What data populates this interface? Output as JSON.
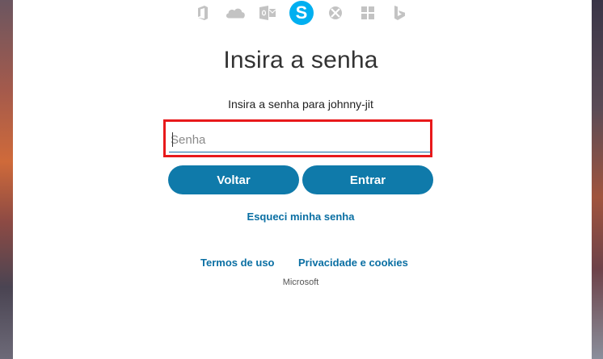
{
  "services": [
    {
      "name": "office-icon"
    },
    {
      "name": "onedrive-icon"
    },
    {
      "name": "outlook-icon"
    },
    {
      "name": "skype-icon",
      "glyph": "S",
      "active": true
    },
    {
      "name": "xbox-icon"
    },
    {
      "name": "windows-icon"
    },
    {
      "name": "bing-icon"
    }
  ],
  "page": {
    "title": "Insira a senha",
    "subtitle": "Insira a senha para johnny-jit"
  },
  "password": {
    "placeholder": "Senha",
    "value": ""
  },
  "buttons": {
    "back": "Voltar",
    "enter": "Entrar"
  },
  "links": {
    "forgot": "Esqueci minha senha",
    "terms": "Termos de uso",
    "privacy": "Privacidade e cookies"
  },
  "footer": {
    "brand": "Microsoft"
  },
  "colors": {
    "accent": "#0f7aaa",
    "link": "#0a6fa3",
    "skype": "#00aff0",
    "highlight": "#e8191b"
  }
}
